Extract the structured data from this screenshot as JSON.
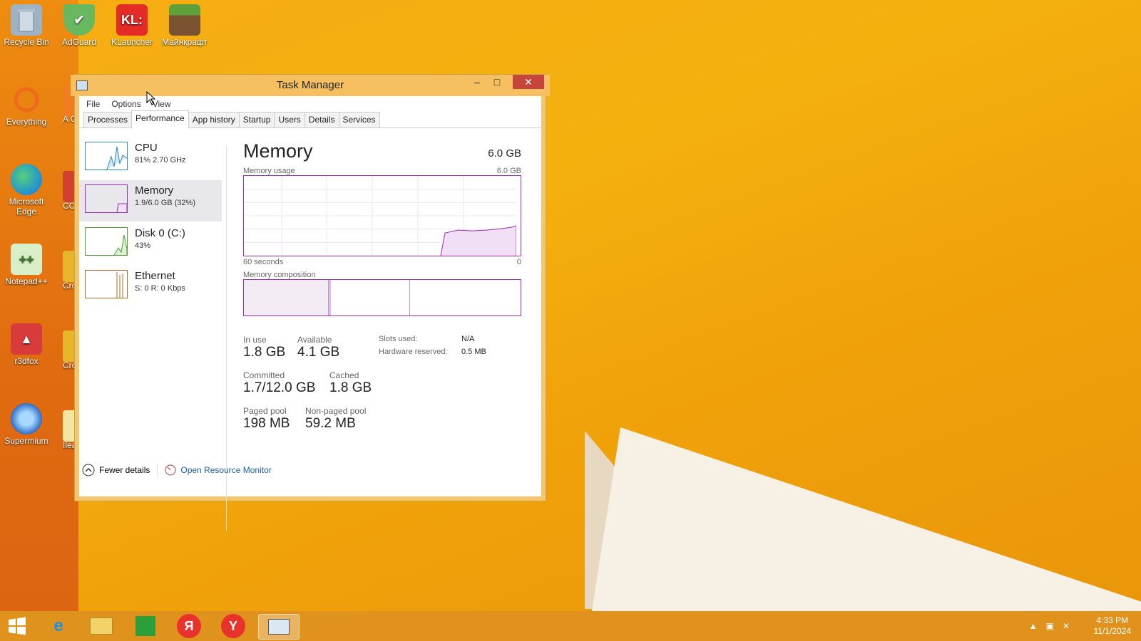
{
  "desktop": {
    "icons": [
      {
        "label": "Recycle Bin",
        "icon": "recycle-bin-icon",
        "color": "#8aa3b8"
      },
      {
        "label": "AdGuard",
        "icon": "adguard-icon",
        "color": "#63b35b"
      },
      {
        "label": "KLauncher",
        "icon": "klauncher-icon",
        "color": "#e52b25"
      },
      {
        "label": "Майнкрафт",
        "icon": "minecraft-icon",
        "color": "#5b7f34"
      },
      {
        "label": "Everything",
        "icon": "everything-icon",
        "color": "#e25818"
      },
      {
        "label": "Microsoft Edge",
        "icon": "edge-icon",
        "color": "#1f8fd6"
      },
      {
        "label": "Notepad++",
        "icon": "notepad-plus-plus-icon",
        "color": "#7fbf4f"
      },
      {
        "label": "r3dfox",
        "icon": "r3dfox-icon",
        "color": "#d93a3a"
      },
      {
        "label": "Supermium",
        "icon": "supermium-icon",
        "color": "#2d6fc9"
      }
    ],
    "partial_labels": [
      "A\nCle",
      "CC",
      "Cro",
      "Cro",
      "Ilea"
    ],
    "klauncher_glyph": "KL:",
    "minecraft_glyph": ""
  },
  "window": {
    "title": "Task Manager",
    "minimize_glyph": "–",
    "maximize_glyph": "□",
    "close_glyph": "✕",
    "menu": [
      "File",
      "Options",
      "View"
    ],
    "tabs": [
      "Processes",
      "Performance",
      "App history",
      "Startup",
      "Users",
      "Details",
      "Services"
    ],
    "active_tab": "Performance",
    "sidebar": [
      {
        "title": "CPU",
        "sub": "81%  2.70 GHz",
        "color": "#2c8ac4"
      },
      {
        "title": "Memory",
        "sub": "1.9/6.0 GB (32%)",
        "color": "#9b2bb2"
      },
      {
        "title": "Disk 0 (C:)",
        "sub": "43%",
        "color": "#4a9f2c"
      },
      {
        "title": "Ethernet",
        "sub": "S: 0 R: 0 Kbps",
        "color": "#b86a1b"
      }
    ],
    "main": {
      "title": "Memory",
      "total": "6.0 GB",
      "usage_label": "Memory usage",
      "usage_max": "6.0 GB",
      "graph_left": "60 seconds",
      "graph_right": "0",
      "usage_fraction": 0.32,
      "composition_label": "Memory composition",
      "stats": {
        "in_use_label": "In use",
        "in_use": "1.8 GB",
        "available_label": "Available",
        "available": "4.1 GB",
        "slots_label": "Slots used:",
        "slots": "N/A",
        "hw_label": "Hardware reserved:",
        "hw": "0.5 MB",
        "committed_label": "Committed",
        "committed": "1.7/12.0 GB",
        "cached_label": "Cached",
        "cached": "1.8 GB",
        "paged_label": "Paged pool",
        "paged": "198 MB",
        "nonpaged_label": "Non-paged pool",
        "nonpaged": "59.2 MB"
      }
    },
    "footer": {
      "fewer": "Fewer details",
      "monitor": "Open Resource Monitor"
    }
  },
  "taskbar": {
    "time": "4:33 PM",
    "date": "11/1/2024",
    "yandex_glyph": "Я",
    "ybrowser_glyph": "Y",
    "tray_up_glyph": "▲",
    "tray_net_glyph": "▣",
    "tray_sound_glyph": "✕"
  }
}
